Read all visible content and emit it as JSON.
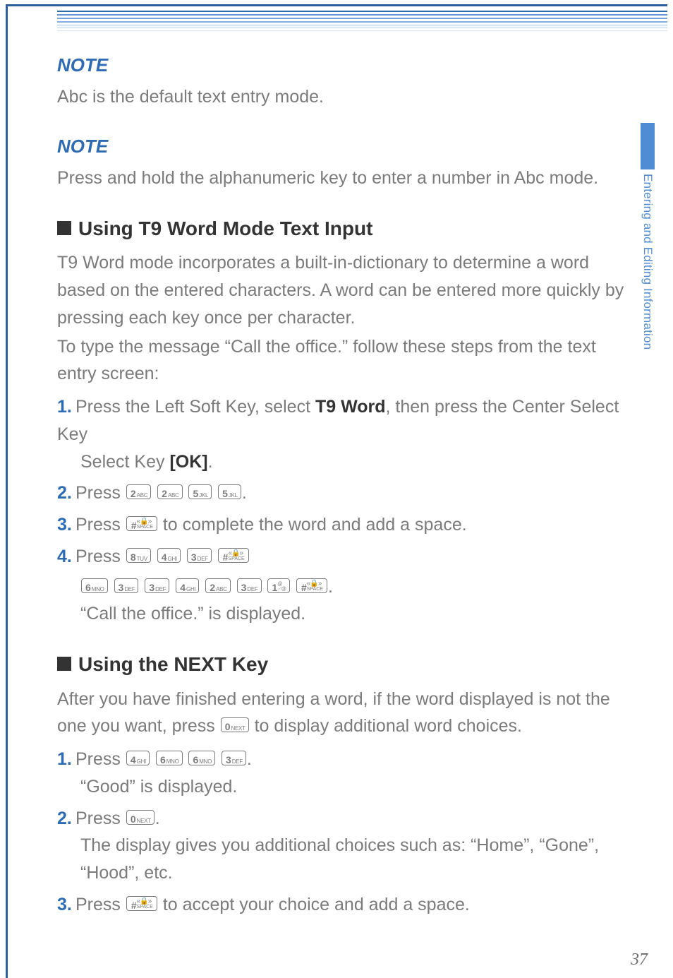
{
  "sideTab": {
    "label": "Entering and Editing Information"
  },
  "pageNumber": "37",
  "notes": {
    "title": "NOTE",
    "n1": "Abc is the default text entry mode.",
    "n2": "Press and hold the alphanumeric key to enter a number in Abc mode."
  },
  "sectionA": {
    "title": "Using T9 Word Mode Text Input",
    "intro1": "T9 Word mode incorporates a built-in-dictionary to determine a word based on the entered characters. A word can be entered more quickly by pressing each key once per character.",
    "intro2": "To type the message “Call the office.” follow these steps from the text entry screen:",
    "steps": {
      "s1a": "Press the Left Soft Key, select ",
      "s1b": "T9 Word",
      "s1c": ", then press the Center Select Key ",
      "s1d": "[OK]",
      "s1e": ".",
      "s2": "Press ",
      "s3a": "Press ",
      "s3b": " to complete the word and add a space.",
      "s4": "Press ",
      "s4end": "“Call the office.” is displayed."
    }
  },
  "sectionB": {
    "title": "Using the NEXT Key",
    "intro_a": "After you have finished entering a word, if the word displayed is not the one you want, press ",
    "intro_b": " to display additional word choices.",
    "steps": {
      "s1": "Press ",
      "s1end": "“Good” is displayed.",
      "s2": "Press ",
      "s2b": "The display gives you additional choices such as: “Home”, “Gone”, “Hood”, etc.",
      "s3a": "Press ",
      "s3b": " to accept your choice and add a space."
    }
  },
  "keys": {
    "k0": {
      "d": "0",
      "s": "NEXT"
    },
    "k1": {
      "d": "1",
      "s": ".-'@"
    },
    "k2": {
      "d": "2",
      "s": "ABC"
    },
    "k3": {
      "d": "3",
      "s": "DEF"
    },
    "k4": {
      "d": "4",
      "s": "GHI"
    },
    "k5": {
      "d": "5",
      "s": "JKL"
    },
    "k6": {
      "d": "6",
      "s": "MNO"
    },
    "k8": {
      "d": "8",
      "s": "TUV"
    },
    "hash": {
      "d": "#",
      "s": "SPACE"
    }
  }
}
